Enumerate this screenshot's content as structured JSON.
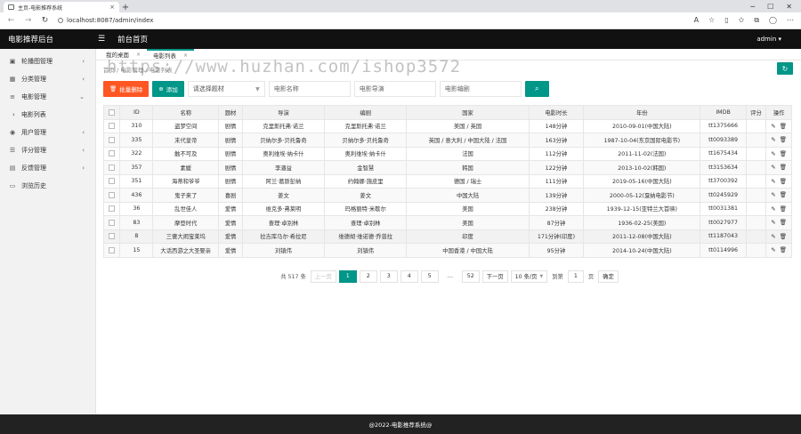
{
  "browser": {
    "tab_title": "主页-电影推荐系统",
    "url": "localhost:8087/admin/index"
  },
  "header": {
    "logo": "电影推荐后台",
    "home_title": "前台首页",
    "user": "admin ▾"
  },
  "sidebar": {
    "items": [
      {
        "label": "轮播图管理",
        "icon": "image-icon",
        "glyph": "▣",
        "chev": "‹"
      },
      {
        "label": "分类管理",
        "icon": "grid-icon",
        "glyph": "▦",
        "chev": "‹"
      },
      {
        "label": "电影管理",
        "icon": "sliders-icon",
        "glyph": "≡",
        "chev": "⌄"
      },
      {
        "label": "用户管理",
        "icon": "user-icon",
        "glyph": "◉",
        "chev": "‹"
      },
      {
        "label": "评分管理",
        "icon": "list-icon",
        "glyph": "☰",
        "chev": "‹"
      },
      {
        "label": "反馈管理",
        "icon": "feedback-icon",
        "glyph": "▤",
        "chev": "‹"
      },
      {
        "label": "浏览历史",
        "icon": "history-icon",
        "glyph": "▭",
        "chev": ""
      }
    ],
    "sub_item": "电影列表"
  },
  "page_tabs": [
    {
      "label": "我的桌面",
      "active": false
    },
    {
      "label": "电影列表",
      "active": true
    }
  ],
  "breadcrumb": "首页 / 电影管理 / 电影列表",
  "watermark": "https://www.huzhan.com/ishop3572",
  "toolbar": {
    "batch_delete": "批量删除",
    "add": "添加",
    "genre_placeholder": "请选择题材",
    "name_placeholder": "电影名称",
    "director_placeholder": "电影导演",
    "writer_placeholder": "电影编剧"
  },
  "table": {
    "headers": [
      "ID",
      "名称",
      "题材",
      "导演",
      "编剧",
      "国家",
      "电影时长",
      "年份",
      "IMDB",
      "评分",
      "操作"
    ],
    "rows": [
      [
        "310",
        "盗梦空间",
        "剧情",
        "克里斯托弗·诺兰",
        "克里斯托弗·诺兰",
        "美国 / 英国",
        "148分钟",
        "2010-09-01(中国大陆)",
        "tt1375666",
        ""
      ],
      [
        "335",
        "末代皇帝",
        "剧情",
        "贝纳尔多·贝托鲁奇",
        "贝纳尔多·贝托鲁奇",
        "英国 / 意大利 / 中国大陆 / 法国",
        "163分钟",
        "1987-10-04(东京国际电影节)",
        "tt0093389",
        ""
      ],
      [
        "322",
        "触不可及",
        "剧情",
        "奥利维埃·纳卡什",
        "奥利维埃·纳卡什",
        "法国",
        "112分钟",
        "2011-11-02(法国)",
        "tt1675434",
        ""
      ],
      [
        "357",
        "素媛",
        "剧情",
        "李濬益",
        "金智慧",
        "韩国",
        "122分钟",
        "2013-10-02(韩国)",
        "tt3153634",
        ""
      ],
      [
        "351",
        "海蒂和爷爷",
        "剧情",
        "阿兰·葛斯彭纳",
        "约翰娜·施皮里",
        "德国 / 瑞士",
        "111分钟",
        "2019-05-16(中国大陆)",
        "tt3700392",
        ""
      ],
      [
        "436",
        "鬼子来了",
        "喜剧",
        "姜文",
        "姜文",
        "中国大陆",
        "139分钟",
        "2000-05-12(戛纳电影节)",
        "tt0245929",
        ""
      ],
      [
        "36",
        "乱世佳人",
        "爱情",
        "维克多·弗莱明",
        "玛格丽特·米歇尔",
        "美国",
        "238分钟",
        "1939-12-15(亚特兰大首映)",
        "tt0031381",
        ""
      ],
      [
        "83",
        "摩登时代",
        "爱情",
        "查理·卓别林",
        "查理·卓别林",
        "美国",
        "87分钟",
        "1936-02-25(美国)",
        "tt0027977",
        ""
      ],
      [
        "8",
        "三傻大闹宝莱坞",
        "爱情",
        "拉吉库马尔·希拉尼",
        "维德胡·维诺德·乔普拉",
        "印度",
        "171分钟(印度)",
        "2011-12-08(中国大陆)",
        "tt1187043",
        ""
      ],
      [
        "15",
        "大话西游之大圣娶亲",
        "爱情",
        "刘镇伟",
        "刘镇伟",
        "中国香港 / 中国大陆",
        "95分钟",
        "2014-10-24(中国大陆)",
        "tt0114996",
        ""
      ]
    ]
  },
  "pager": {
    "total": "共 517 条",
    "prev": "上一页",
    "pages": [
      "1",
      "2",
      "3",
      "4",
      "5",
      "…",
      "52"
    ],
    "next": "下一页",
    "per_page": "10 条/页",
    "goto_label": "到第",
    "goto_value": "1",
    "page_unit": "页",
    "confirm": "确定"
  },
  "footer": "@2022-电影推荐系统@",
  "colors": {
    "accent": "#009688",
    "danger": "#ff5722",
    "header": "#111111"
  }
}
